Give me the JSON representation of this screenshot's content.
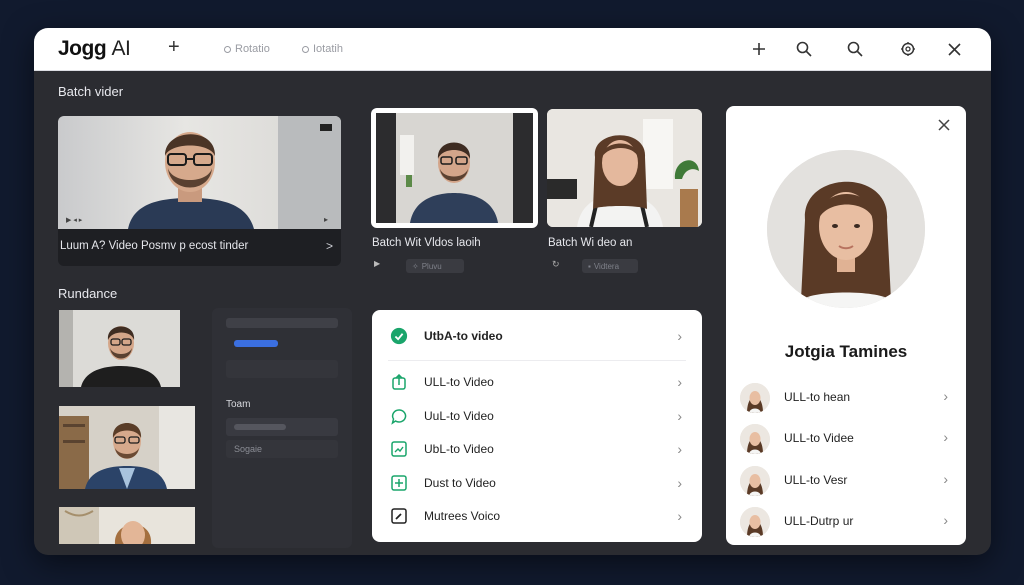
{
  "header": {
    "logo_text": "Jogg",
    "logo_ai": "AI",
    "tabs": [
      "Rotatio",
      "Iotatih"
    ]
  },
  "sections": {
    "batch_title": "Batch vider",
    "rundance_title": "Rundance"
  },
  "main_card": {
    "caption": "Luum A? Video Posmv p ecost tinder",
    "chevron": ">"
  },
  "thumb_cards": [
    {
      "caption": "Batch Wit Vldos laoih",
      "control": "Pluvu"
    },
    {
      "caption": "Batch Wi deo an",
      "control": "Vidtera"
    }
  ],
  "side_column": {
    "label": "Toam",
    "field_text": "Sogaie"
  },
  "menu_list": {
    "items": [
      {
        "label": "UtbA-to video",
        "icon": "check-circle-icon"
      },
      {
        "label": "ULL-to Video",
        "icon": "upload-icon"
      },
      {
        "label": "UuL-to Video",
        "icon": "chat-icon"
      },
      {
        "label": "UbL-to Video",
        "icon": "image-icon"
      },
      {
        "label": "Dust to Video",
        "icon": "plus-box-icon"
      },
      {
        "label": "Mutrees Voico",
        "icon": "edit-icon"
      }
    ]
  },
  "profile_panel": {
    "name": "Jotgia Tamines",
    "items": [
      {
        "label": "ULL-to hean"
      },
      {
        "label": "ULL-to Videe"
      },
      {
        "label": "ULL-to Vesr"
      },
      {
        "label": "ULL-Dutrp ur"
      }
    ]
  },
  "colors": {
    "accent_green": "#1aa56b",
    "accent_blue": "#3b6fe0",
    "window_bg": "#2b2c31"
  }
}
